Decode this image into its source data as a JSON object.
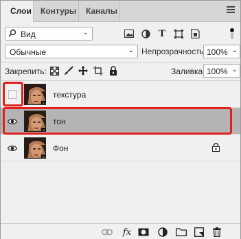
{
  "tabs": [
    {
      "label": "Слои",
      "active": true
    },
    {
      "label": "Контуры",
      "active": false
    },
    {
      "label": "Каналы",
      "active": false
    }
  ],
  "filter": {
    "label": "Вид"
  },
  "blend_mode": {
    "value": "Обычные"
  },
  "opacity": {
    "label": "Непрозрачность:",
    "value": "100%"
  },
  "lock": {
    "label": "Закрепить:"
  },
  "fill": {
    "label": "Заливка:",
    "value": "100%"
  },
  "layers": [
    {
      "name": "текстура",
      "visible": false,
      "selected": false,
      "locked": false
    },
    {
      "name": "тон",
      "visible": true,
      "selected": true,
      "locked": false
    },
    {
      "name": "Фон",
      "visible": true,
      "selected": false,
      "locked": true
    }
  ],
  "bottom_toolbar": {
    "fx_label": "fx"
  },
  "colors": {
    "highlight": "#e0201b",
    "selected_row": "#b4b4b4",
    "panel_bg": "#f0f0f0"
  }
}
